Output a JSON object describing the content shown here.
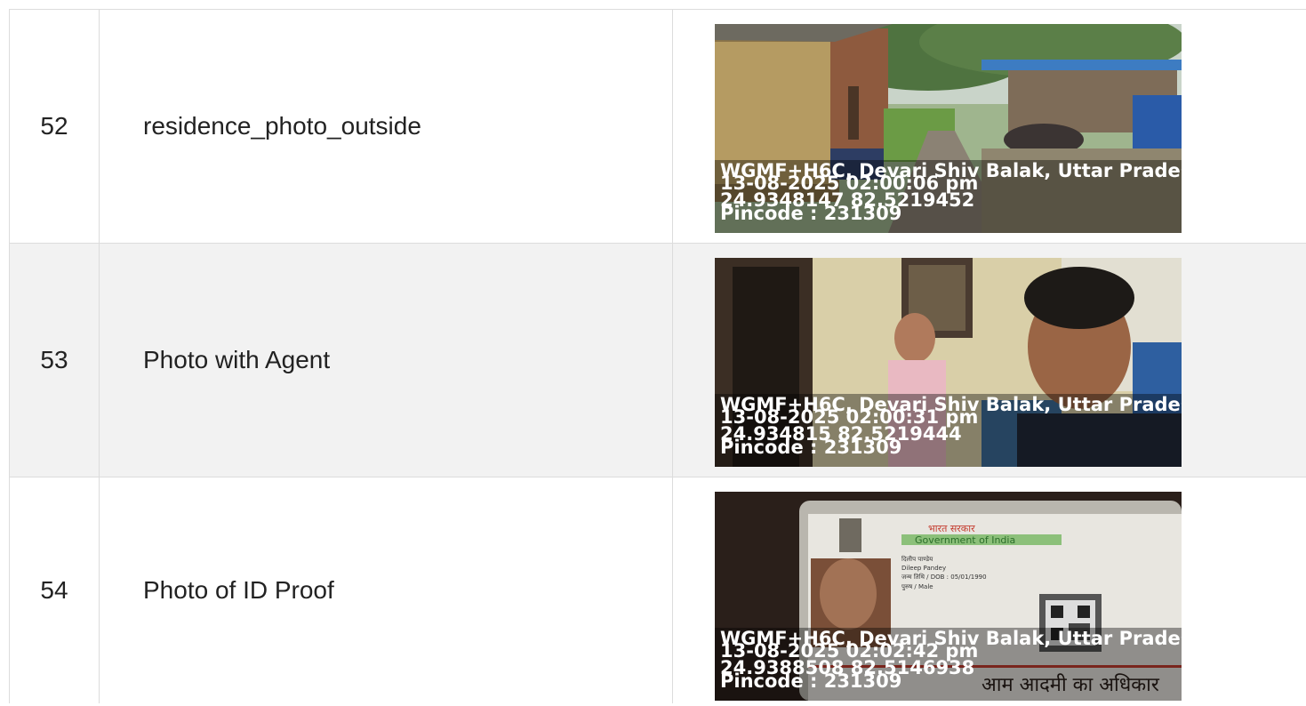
{
  "rows": [
    {
      "number": "52",
      "label": "residence_photo_outside",
      "stamp": {
        "address": "WGMF+H6C, Devari Shiv Balak, Uttar Prades",
        "datetime": "13-08-2025 02:00:06 pm",
        "coords": "24.9348147 82.5219452",
        "pincode": "Pincode : 231309"
      }
    },
    {
      "number": "53",
      "label": "Photo with Agent",
      "stamp": {
        "address": "WGMF+H6C, Devari Shiv Balak, Uttar Prades",
        "datetime": "13-08-2025 02:00:31 pm",
        "coords": "24.934815 82.5219444",
        "pincode": "Pincode : 231309"
      }
    },
    {
      "number": "54",
      "label": "Photo of ID Proof",
      "stamp": {
        "address": "WGMF+H6C, Devari Shiv Balak, Uttar Prades",
        "datetime": "13-08-2025 02:02:42 pm",
        "coords": "24.9388508 82.5146938",
        "pincode": "Pincode : 231309"
      },
      "id_card": {
        "header_hindi": "भारत सरकार",
        "header_english": "Government of India",
        "name_hindi": "दिलीप पाण्डेय",
        "name_english": "Dileep Pandey",
        "dob": "जन्म तिथि / DOB : 05/01/1990",
        "gender": "पुरुष / Male",
        "footer_hindi": "आम आदमी का अधिकार"
      }
    }
  ]
}
